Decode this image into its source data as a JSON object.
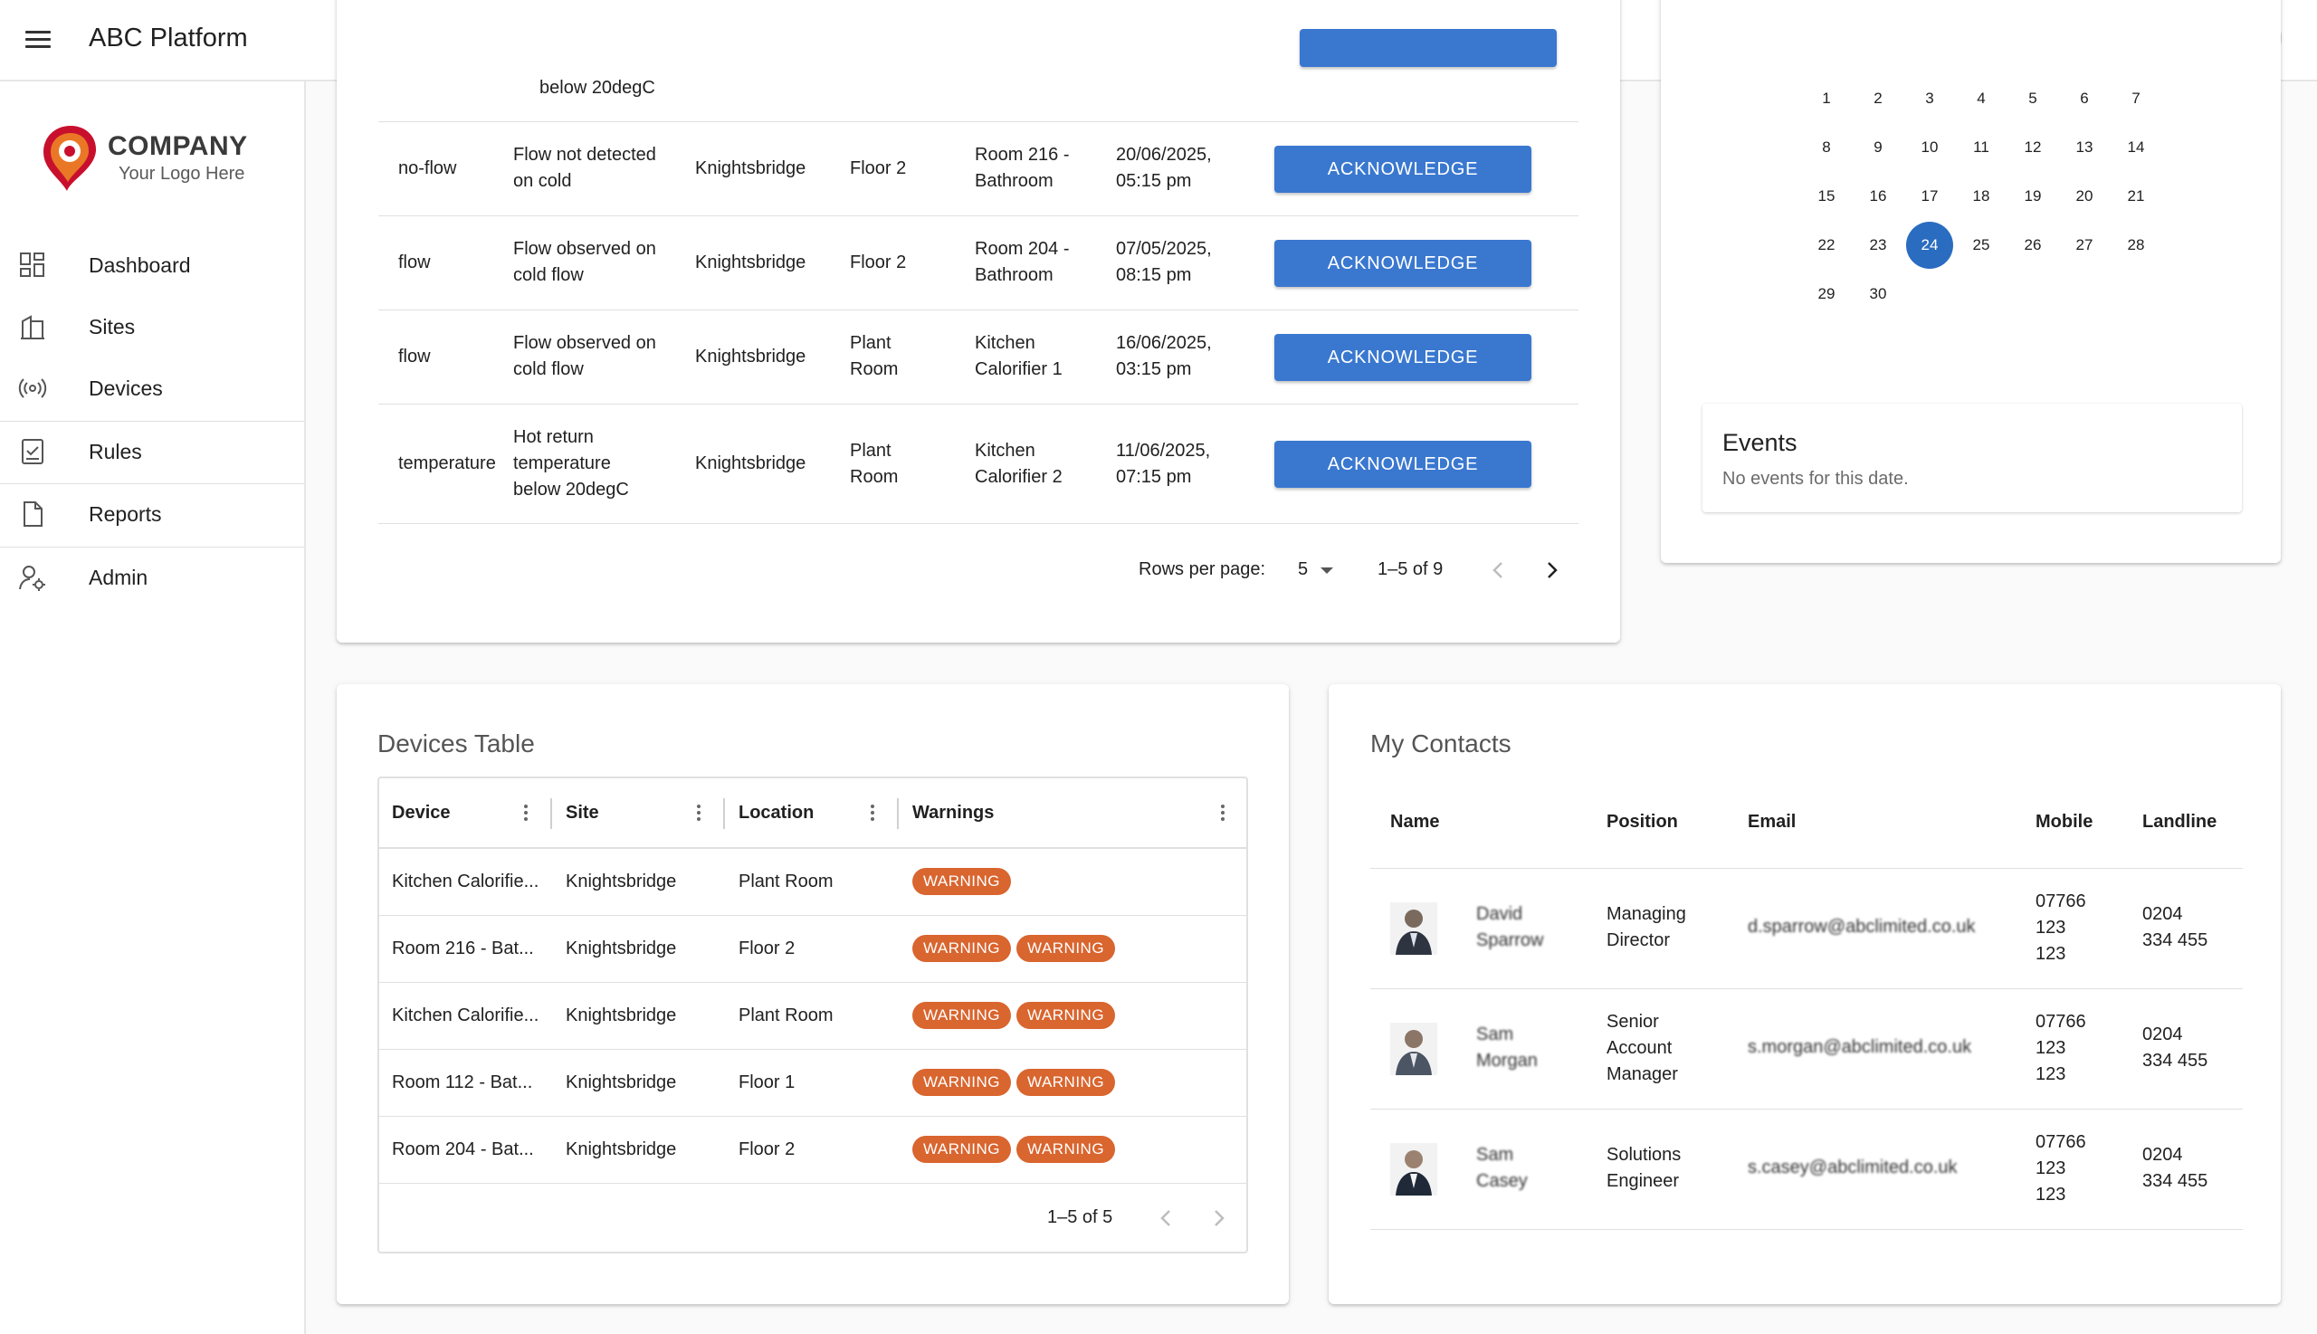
{
  "appbar": {
    "title": "ABC Platform"
  },
  "logo": {
    "name": "COMPANY",
    "tagline": "Your Logo Here"
  },
  "nav": [
    {
      "label": "Dashboard",
      "icon": "dashboard-icon"
    },
    {
      "label": "Sites",
      "icon": "building-icon"
    },
    {
      "label": "Devices",
      "icon": "sensor-icon"
    },
    {
      "label": "Rules",
      "icon": "checklist-icon"
    },
    {
      "label": "Reports",
      "icon": "file-icon"
    },
    {
      "label": "Admin",
      "icon": "user-settings-icon"
    }
  ],
  "alerts": {
    "partial_row": {
      "description": "below 20degC"
    },
    "rows": [
      {
        "type": "no-flow",
        "description_1": "Flow not detected",
        "description_2": "on cold",
        "description_3": "",
        "site": "Knightsbridge",
        "floor_1": "Floor 2",
        "floor_2": "",
        "location_1": "Room 216 -",
        "location_2": "Bathroom",
        "time_1": "20/06/2025,",
        "time_2": "05:15 pm",
        "action": "ACKNOWLEDGE"
      },
      {
        "type": "flow",
        "description_1": "Flow observed on",
        "description_2": "cold flow",
        "description_3": "",
        "site": "Knightsbridge",
        "floor_1": "Floor 2",
        "floor_2": "",
        "location_1": "Room 204 -",
        "location_2": "Bathroom",
        "time_1": "07/05/2025,",
        "time_2": "08:15 pm",
        "action": "ACKNOWLEDGE"
      },
      {
        "type": "flow",
        "description_1": "Flow observed on",
        "description_2": "cold flow",
        "description_3": "",
        "site": "Knightsbridge",
        "floor_1": "Plant",
        "floor_2": "Room",
        "location_1": "Kitchen",
        "location_2": "Calorifier 1",
        "time_1": "16/06/2025,",
        "time_2": "03:15 pm",
        "action": "ACKNOWLEDGE"
      },
      {
        "type": "temperature",
        "description_1": "Hot return",
        "description_2": "temperature",
        "description_3": "below 20degC",
        "site": "Knightsbridge",
        "floor_1": "Plant",
        "floor_2": "Room",
        "location_1": "Kitchen",
        "location_2": "Calorifier 2",
        "time_1": "11/06/2025,",
        "time_2": "07:15 pm",
        "action": "ACKNOWLEDGE"
      }
    ],
    "pagination": {
      "rows_per_page_label": "Rows per page:",
      "rows_per_page": "5",
      "range": "1–5 of 9"
    }
  },
  "calendar": {
    "days": [
      "1",
      "2",
      "3",
      "4",
      "5",
      "6",
      "7",
      "8",
      "9",
      "10",
      "11",
      "12",
      "13",
      "14",
      "15",
      "16",
      "17",
      "18",
      "19",
      "20",
      "21",
      "22",
      "23",
      "24",
      "25",
      "26",
      "27",
      "28",
      "29",
      "30"
    ],
    "selected_day": "24",
    "events_title": "Events",
    "events_empty": "No events for this date.",
    "accent": "#2a6cc0"
  },
  "devices": {
    "title": "Devices Table",
    "columns": [
      "Device",
      "Site",
      "Location",
      "Warnings"
    ],
    "rows": [
      {
        "device": "Kitchen Calorifie...",
        "site": "Knightsbridge",
        "location": "Plant Room",
        "warnings": [
          "WARNING"
        ]
      },
      {
        "device": "Room 216 - Bat...",
        "site": "Knightsbridge",
        "location": "Floor 2",
        "warnings": [
          "WARNING",
          "WARNING"
        ]
      },
      {
        "device": "Kitchen Calorifie...",
        "site": "Knightsbridge",
        "location": "Plant Room",
        "warnings": [
          "WARNING",
          "WARNING"
        ]
      },
      {
        "device": "Room 112 - Bat...",
        "site": "Knightsbridge",
        "location": "Floor 1",
        "warnings": [
          "WARNING",
          "WARNING"
        ]
      },
      {
        "device": "Room 204 - Bat...",
        "site": "Knightsbridge",
        "location": "Floor 2",
        "warnings": [
          "WARNING",
          "WARNING"
        ]
      }
    ],
    "range": "1–5 of 5",
    "warning_color": "#d9652f"
  },
  "contacts": {
    "title": "My Contacts",
    "columns": [
      "Name",
      "Position",
      "Email",
      "Mobile",
      "Landline"
    ],
    "rows": [
      {
        "name_1": "David",
        "name_2": "Sparrow",
        "position_1": "Managing",
        "position_2": "Director",
        "position_3": "",
        "email": "d.sparrow@abclimited.co.uk",
        "mobile_1": "07766",
        "mobile_2": "123",
        "mobile_3": "123",
        "landline_1": "0204",
        "landline_2": "334 455"
      },
      {
        "name_1": "Sam",
        "name_2": "Morgan",
        "position_1": "Senior",
        "position_2": "Account",
        "position_3": "Manager",
        "email": "s.morgan@abclimited.co.uk",
        "mobile_1": "07766",
        "mobile_2": "123",
        "mobile_3": "123",
        "landline_1": "0204",
        "landline_2": "334 455"
      },
      {
        "name_1": "Sam",
        "name_2": "Casey",
        "position_1": "Solutions",
        "position_2": "Engineer",
        "position_3": "",
        "email": "s.casey@abclimited.co.uk",
        "mobile_1": "07766",
        "mobile_2": "123",
        "mobile_3": "123",
        "landline_1": "0204",
        "landline_2": "334 455"
      }
    ]
  },
  "colors": {
    "primary_button": "#3a78d0",
    "logo_red": "#c8102e",
    "logo_orange": "#f08a24"
  }
}
